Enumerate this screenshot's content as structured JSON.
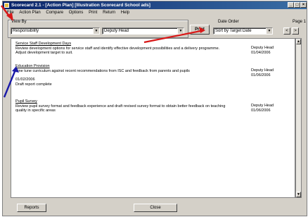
{
  "window": {
    "title": "Scorecard 2.1 - [Action Plan] [Illustration Scorecard School ads]",
    "controls": [
      "_",
      "□",
      "×"
    ]
  },
  "menu": [
    "File",
    "Action Plan",
    "Compare",
    "Options",
    "Print",
    "Return",
    "Help"
  ],
  "view_by": {
    "label": "View By",
    "field1": "Responsibility",
    "field2": "Deputy Head"
  },
  "print_button": "Print",
  "date_order": {
    "label": "Date Order",
    "value": "Sort by Target Date"
  },
  "page": {
    "label": "Page 1",
    "prev": "<",
    "next": ">"
  },
  "items": [
    {
      "heading": "Service Staff Development Days",
      "text": "Review development options for service staff and identify effective development possibilities and a delivery programme. Adjust development target to suit.",
      "note": "",
      "person": "Deputy Head",
      "date": "01/04/2006"
    },
    {
      "heading": "Education Provision",
      "text": "Fine tune curriculum against recent recommendations from ISC and feedback from parents and pupils",
      "note_date": "01/02/2006",
      "note": "Draft report complete",
      "person": "Deputy Head",
      "date": "01/06/2006"
    },
    {
      "heading": "Pupil Survey",
      "text": "Review pupil survey format and feedback experience and draft revised survey format to obtain better feedback on teaching quality in specific areas",
      "note": "",
      "person": "Deputy Head",
      "date": "01/06/2006"
    }
  ],
  "bottom": {
    "reports": "Reports",
    "close": "Close"
  },
  "colors": {
    "titlebar": "#0a246a",
    "arrow": "#d81818",
    "arrow_blue": "#1a1aa8"
  }
}
